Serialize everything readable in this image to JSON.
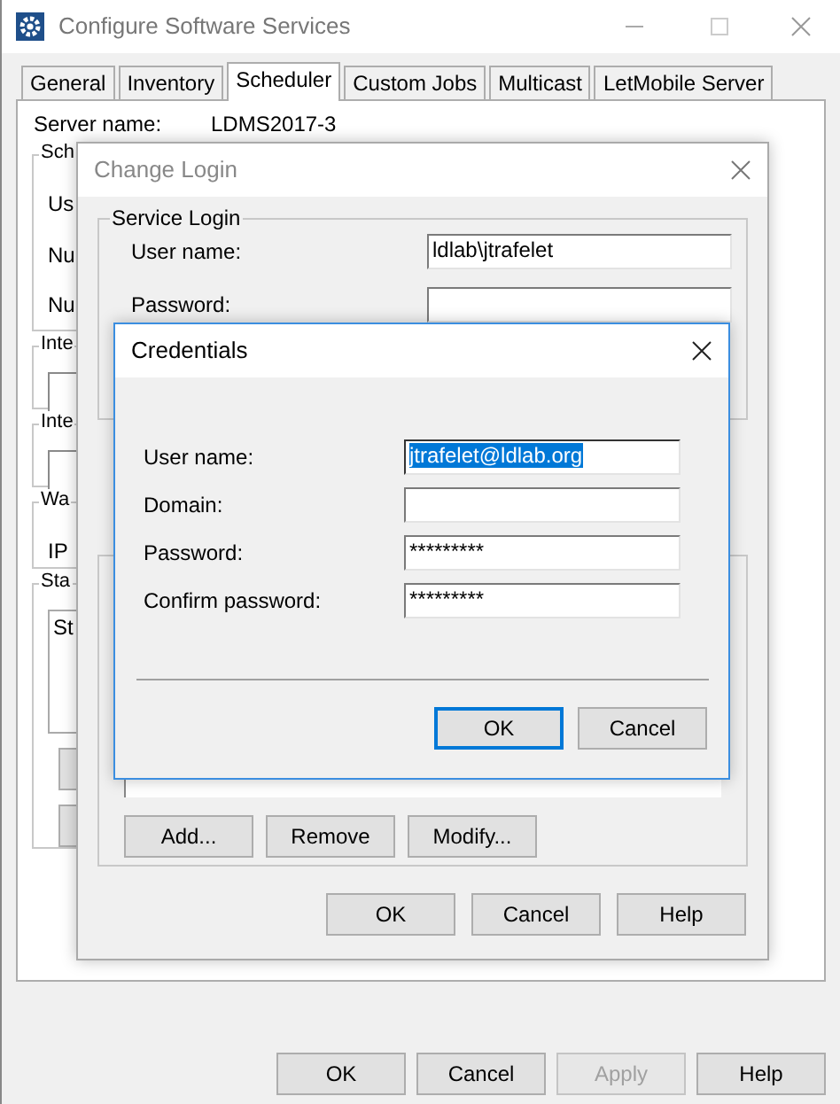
{
  "window": {
    "title": "Configure Software Services"
  },
  "tabs": [
    {
      "label": "General",
      "selected": false
    },
    {
      "label": "Inventory",
      "selected": false
    },
    {
      "label": "Scheduler",
      "selected": true
    },
    {
      "label": "Custom Jobs",
      "selected": false
    },
    {
      "label": "Multicast",
      "selected": false
    },
    {
      "label": "LetMobile Server",
      "selected": false
    }
  ],
  "server_name": {
    "label": "Server name:",
    "value": "LDMS2017-3"
  },
  "background_groups": [
    {
      "title": "Sch",
      "items": [
        {
          "kind": "text",
          "text": "Us"
        },
        {
          "kind": "text",
          "text": "Nu"
        },
        {
          "kind": "text",
          "text": "Nu"
        }
      ]
    },
    {
      "title": "Inte",
      "items": [
        {
          "kind": "field"
        }
      ]
    },
    {
      "title": "Inte",
      "items": [
        {
          "kind": "field"
        }
      ]
    },
    {
      "title": "Wa",
      "items": [
        {
          "kind": "text",
          "text": "IP"
        }
      ]
    },
    {
      "title": "Sta",
      "items": [
        {
          "kind": "list",
          "text": "St"
        },
        {
          "kind": "button"
        },
        {
          "kind": "button"
        }
      ]
    }
  ],
  "buttons": [
    {
      "label": "OK",
      "disabled": false
    },
    {
      "label": "Cancel",
      "disabled": false
    },
    {
      "label": "Apply",
      "disabled": true
    },
    {
      "label": "Help",
      "disabled": false
    }
  ],
  "change_login": {
    "title": "Change Login",
    "service_login": {
      "title": "Service Login",
      "fields": [
        {
          "label": "User name:",
          "value": "ldlab\\jtrafelet"
        },
        {
          "label": "Password:"
        }
      ]
    },
    "list_buttons": [
      "Add...",
      "Remove",
      "Modify..."
    ],
    "buttons": [
      "OK",
      "Cancel",
      "Help"
    ]
  },
  "credentials": {
    "title": "Credentials",
    "fields": [
      {
        "label": "User name:",
        "value": "jtrafelet@ldlab.org",
        "selected": true
      },
      {
        "label": "Domain:",
        "selected": false
      },
      {
        "label": "Password:",
        "value": "*********",
        "selected": false
      },
      {
        "label": "Confirm password:",
        "value": "*********",
        "selected": false
      }
    ],
    "buttons": [
      {
        "label": "OK",
        "default": true
      },
      {
        "label": "Cancel",
        "default": false
      }
    ]
  }
}
